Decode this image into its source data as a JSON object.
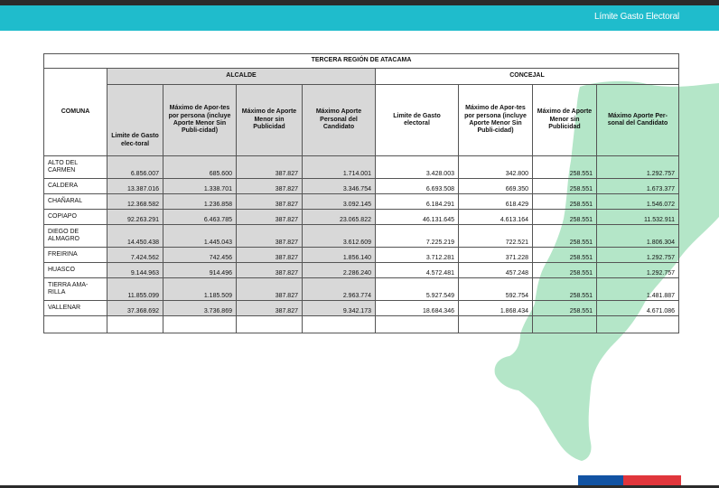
{
  "header": {
    "title": "Límite Gasto Electoral"
  },
  "colors": {
    "header_bar": "#1fbccc",
    "map_fill": "#b4e6c8",
    "table_shade": "#d8d8d8",
    "flag_blue": "#1253a3",
    "flag_red": "#e0363c"
  },
  "table": {
    "title": "TERCERA REGIÓN DE ATACAMA",
    "comuna_header": "COMUNA",
    "group_alcalde": "ALCALDE",
    "group_concejal": "CONCEJAL",
    "alcalde_cols": [
      "Limite de Gasto elec-toral",
      "Máximo de Apor-tes por persona (incluye Aporte Menor Sin Publi-cidad)",
      "Máximo de Aporte Menor sin Publicidad",
      "Máximo Aporte Personal del Candidato"
    ],
    "concejal_cols": [
      "Limite de Gasto electoral",
      "Máximo de Apor-tes por persona (incluye Aporte Menor Sin Publi-cidad)",
      "Máximo de Aporte Menor sin Publicidad",
      "Máximo Aporte Per-sonal del Candidato"
    ],
    "rows": [
      {
        "comuna": "ALTO DEL CARMEN",
        "values": [
          "6.856.007",
          "685.600",
          "387.827",
          "1.714.001",
          "3.428.003",
          "342.800",
          "258.551",
          "1.292.757"
        ]
      },
      {
        "comuna": "CALDERA",
        "values": [
          "13.387.016",
          "1.338.701",
          "387.827",
          "3.346.754",
          "6.693.508",
          "669.350",
          "258.551",
          "1.673.377"
        ]
      },
      {
        "comuna": "CHAÑARAL",
        "values": [
          "12.368.582",
          "1.236.858",
          "387.827",
          "3.092.145",
          "6.184.291",
          "618.429",
          "258.551",
          "1.546.072"
        ]
      },
      {
        "comuna": "COPIAPO",
        "values": [
          "92.263.291",
          "6.463.785",
          "387.827",
          "23.065.822",
          "46.131.645",
          "4.613.164",
          "258.551",
          "11.532.911"
        ]
      },
      {
        "comuna": "DIEGO DE ALMAGRO",
        "values": [
          "14.450.438",
          "1.445.043",
          "387.827",
          "3.612.609",
          "7.225.219",
          "722.521",
          "258.551",
          "1.806.304"
        ]
      },
      {
        "comuna": "FREIRINA",
        "values": [
          "7.424.562",
          "742.456",
          "387.827",
          "1.856.140",
          "3.712.281",
          "371.228",
          "258.551",
          "1.292.757"
        ]
      },
      {
        "comuna": "HUASCO",
        "values": [
          "9.144.963",
          "914.496",
          "387.827",
          "2.286.240",
          "4.572.481",
          "457.248",
          "258.551",
          "1.292.757"
        ]
      },
      {
        "comuna": "TIERRA AMA-RILLA",
        "values": [
          "11.855.099",
          "1.185.509",
          "387.827",
          "2.963.774",
          "5.927.549",
          "592.754",
          "258.551",
          "1.481.887"
        ]
      },
      {
        "comuna": "VALLENAR",
        "values": [
          "37.368.692",
          "3.736.869",
          "387.827",
          "9.342.173",
          "18.684.346",
          "1.868.434",
          "258.551",
          "4.671.086"
        ]
      }
    ]
  }
}
